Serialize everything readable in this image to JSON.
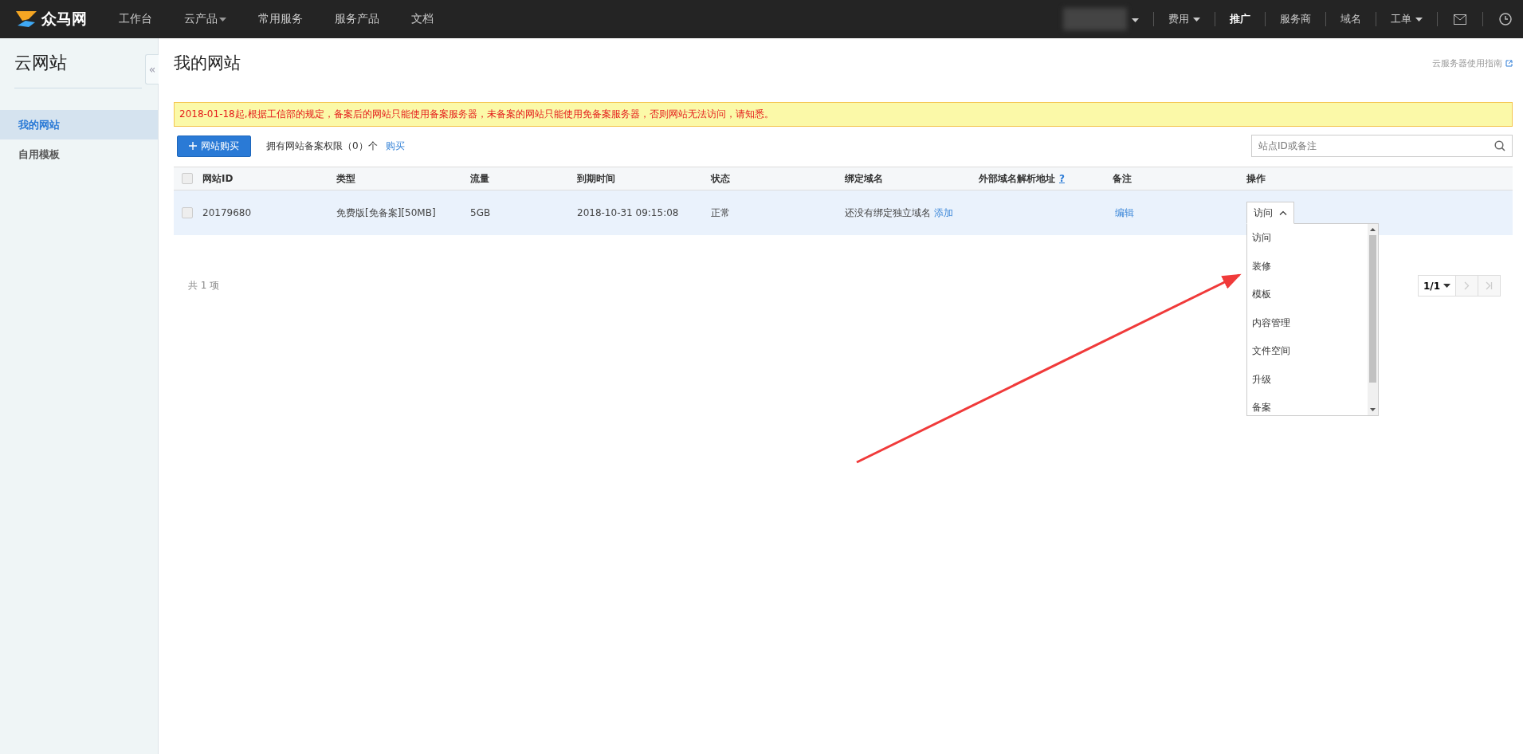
{
  "top_nav": {
    "logo_text": "众马网",
    "items": [
      {
        "label": "工作台",
        "dropdown": false
      },
      {
        "label": "云产品",
        "dropdown": true
      },
      {
        "label": "常用服务",
        "dropdown": false
      },
      {
        "label": "服务产品",
        "dropdown": false
      },
      {
        "label": "文档",
        "dropdown": false
      }
    ],
    "right_items": [
      {
        "label": "费用",
        "dropdown": true,
        "bold": false
      },
      {
        "label": "推广",
        "dropdown": false,
        "bold": true
      },
      {
        "label": "服务商",
        "dropdown": false,
        "bold": false
      },
      {
        "label": "域名",
        "dropdown": false,
        "bold": false
      },
      {
        "label": "工单",
        "dropdown": true,
        "bold": false
      }
    ]
  },
  "sidebar": {
    "title": "云网站",
    "collapse_glyph": "«",
    "items": [
      {
        "label": "我的网站",
        "selected": true
      },
      {
        "label": "自用模板",
        "selected": false
      }
    ]
  },
  "page": {
    "title": "我的网站",
    "help_link": "云服务器使用指南"
  },
  "notice": "2018-01-18起,根据工信部的规定，备案后的网站只能使用备案服务器，未备案的网站只能使用免备案服务器，否则网站无法访问，请知悉。",
  "toolbar": {
    "buy_button": "网站购买",
    "quota_text": "拥有网站备案权限（0）个",
    "buy_link": "购买",
    "search_placeholder": "站点ID或备注"
  },
  "table": {
    "header_checked": false,
    "columns": [
      {
        "label": "网站ID"
      },
      {
        "label": "类型"
      },
      {
        "label": "流量"
      },
      {
        "label": "到期时间"
      },
      {
        "label": "状态"
      },
      {
        "label": "绑定域名"
      },
      {
        "label": "外部域名解析地址",
        "help": "?"
      },
      {
        "label": "备注"
      },
      {
        "label": "操作"
      }
    ],
    "rows": [
      {
        "checked": false,
        "id": "20179680",
        "type": "免费版[免备案][50MB]",
        "traffic": "5GB",
        "expires": "2018-10-31 09:15:08",
        "status": "正常",
        "domain": "还没有绑定独立域名",
        "domain_link": "添加",
        "remark_link": "编辑",
        "action": {
          "value": "访问",
          "expanded": true,
          "options": [
            "访问",
            "装修",
            "模板",
            "内容管理",
            "文件空间",
            "升级",
            "备案"
          ]
        }
      }
    ]
  },
  "pagination": {
    "total": "共 1 项",
    "page": "1/1",
    "next_disabled": true,
    "last_disabled": true
  }
}
